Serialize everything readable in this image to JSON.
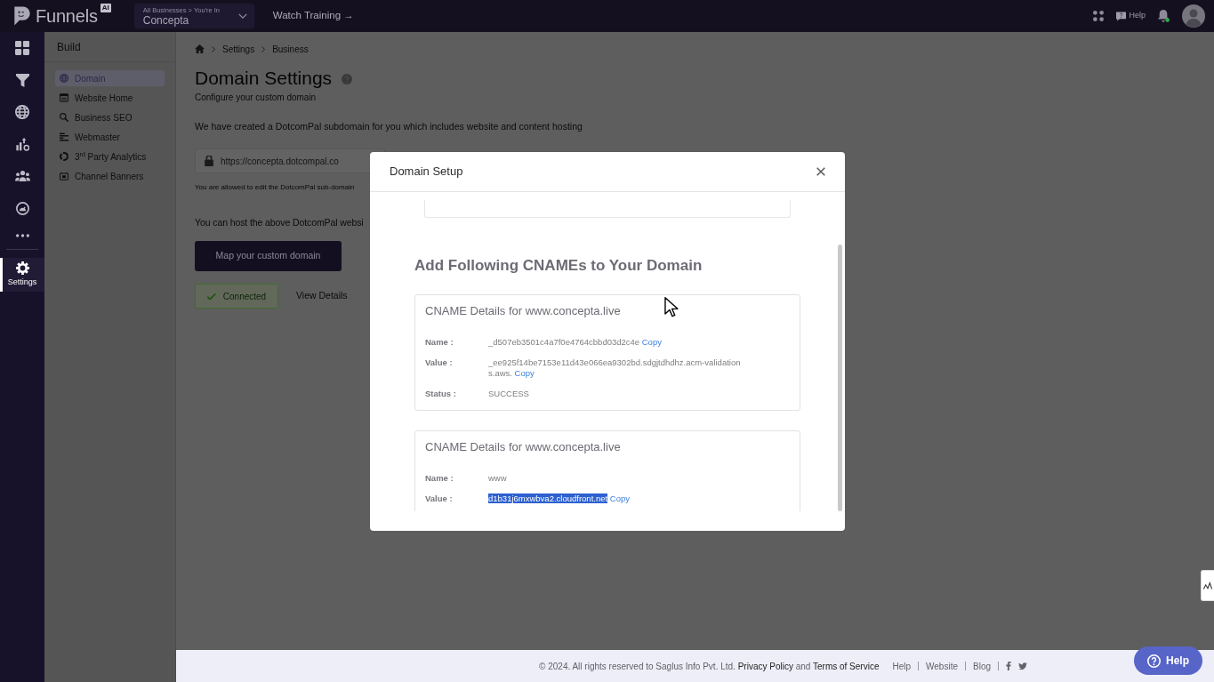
{
  "topbar": {
    "brand": "Funnels",
    "brand_badge": "AI",
    "business_switcher": {
      "caption": "All Businesses > You're In",
      "value": "Concepta"
    },
    "watch_training": "Watch Training →",
    "help": "Help"
  },
  "rail": {
    "items": [
      {
        "selected": false
      },
      {
        "selected": false
      },
      {
        "selected": false
      },
      {
        "selected": false
      },
      {
        "selected": false
      },
      {
        "selected": false
      },
      {
        "selected": false
      },
      {
        "label": "Settings",
        "selected": true
      }
    ]
  },
  "sidebar": {
    "title": "Build",
    "items": [
      {
        "label": "Domain",
        "selected": true
      },
      {
        "label": "Website Home",
        "selected": false
      },
      {
        "label": "Business SEO",
        "selected": false
      },
      {
        "label": "Webmaster",
        "selected": false
      },
      {
        "label": "3$^{rd}$ Party Analytics",
        "selected": false
      },
      {
        "label": "Channel Banners",
        "selected": false
      }
    ]
  },
  "breadcrumb": {
    "items": [
      "Settings",
      "Business"
    ]
  },
  "page": {
    "title": "Domain Settings",
    "subtitle": "Configure your custom domain",
    "intro": "We have created a DotcomPal subdomain for you which includes website and content hosting",
    "subdomain_field": {
      "value": "https://concepta.dotcompal.co"
    },
    "field_hint": "You are allowed to edit the DotcomPal sub-domain",
    "hosting_text": "You can host the above DotcomPal websi",
    "map_button": "Map your custom domain",
    "status_button": "Connected",
    "view_details": "View Details"
  },
  "modal": {
    "title": "Domain Setup",
    "heading": "Add Following CNAMEs to Your Domain",
    "cards": [
      {
        "title": "CNAME Details for www.concepta.live",
        "rows": [
          {
            "label": "Name :",
            "value": "_d507eb3501c4a7f0e4764cbbd03d2c4e",
            "copy": "Copy",
            "highlighted": false
          },
          {
            "label": "Value :",
            "value": "_ee925f14be7153e11d43e066ea9302bd.sdgjtdhdhz.acm-validations.aws.",
            "copy": "Copy",
            "highlighted": false
          },
          {
            "label": "Status :",
            "value": "SUCCESS",
            "highlighted": false
          }
        ]
      },
      {
        "title": "CNAME Details for www.concepta.live",
        "rows": [
          {
            "label": "Name :",
            "value": "www",
            "highlighted": false
          },
          {
            "label": "Value :",
            "value": "d1b31j6mxwbva2.cloudfront.net",
            "copy": "Copy",
            "highlighted": true
          }
        ]
      }
    ]
  },
  "footer": {
    "copyright": [
      {
        "kind": "text",
        "text": "©  2024. All rights reserved to Saglus Info Pvt. Ltd."
      },
      {
        "kind": "link",
        "text": "Privacy Policy"
      },
      {
        "kind": "text",
        "text": "and"
      },
      {
        "kind": "link",
        "text": "Terms of Service"
      }
    ],
    "links": [
      "Help",
      "Website",
      "Blog"
    ]
  },
  "help_button": "Help"
}
